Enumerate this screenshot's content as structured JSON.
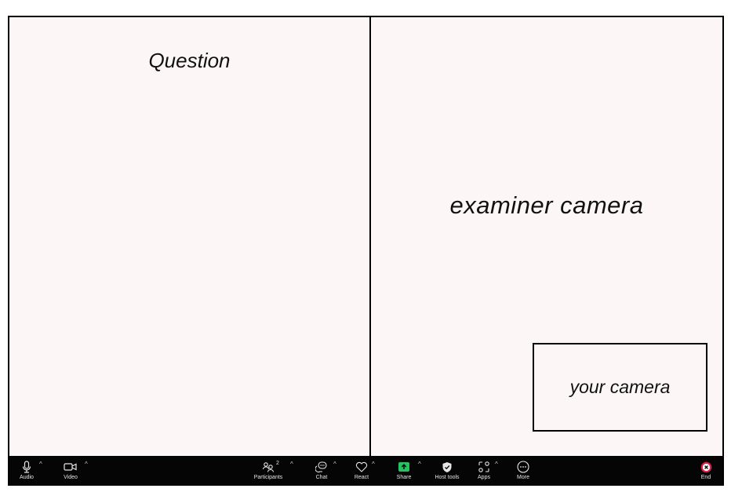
{
  "panels": {
    "question_label": "Question",
    "examiner_label": "examiner camera",
    "self_label": "your camera"
  },
  "toolbar": {
    "audio": {
      "label": "Audio",
      "icon": "microphone-icon"
    },
    "video": {
      "label": "Video",
      "icon": "video-camera-icon"
    },
    "participants": {
      "label": "Participants",
      "count": "2",
      "icon": "participants-icon"
    },
    "chat": {
      "label": "Chat",
      "icon": "chat-icon"
    },
    "react": {
      "label": "React",
      "icon": "heart-icon"
    },
    "share": {
      "label": "Share",
      "icon": "share-screen-icon",
      "accent": "#22c55e"
    },
    "host_tools": {
      "label": "Host tools",
      "icon": "shield-icon"
    },
    "apps": {
      "label": "Apps",
      "icon": "apps-icon"
    },
    "more": {
      "label": "More",
      "icon": "more-icon"
    },
    "end": {
      "label": "End",
      "icon": "close-icon",
      "accent": "#e11d48"
    },
    "caret": "^"
  }
}
